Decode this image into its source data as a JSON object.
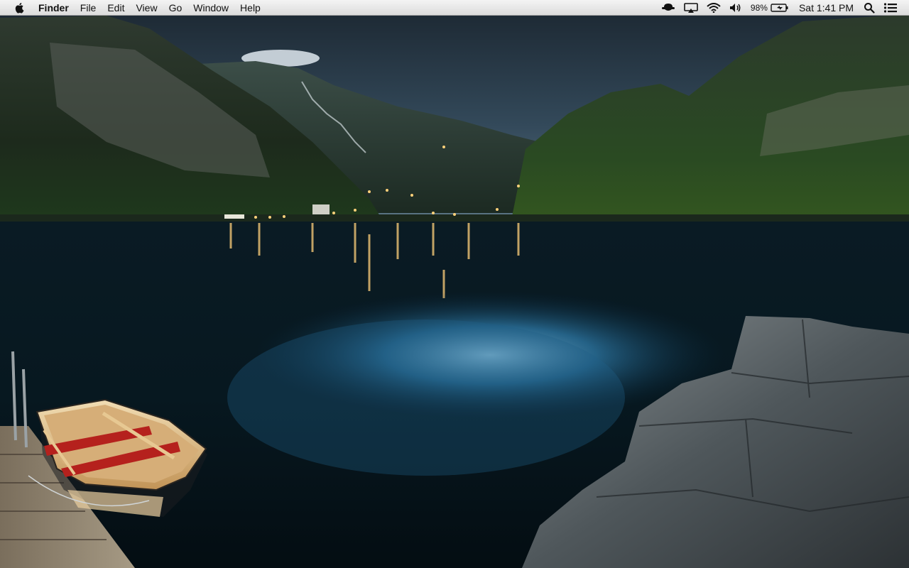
{
  "menubar": {
    "apple_icon": "apple-logo-icon",
    "app_name": "Finder",
    "menus": [
      "File",
      "Edit",
      "View",
      "Go",
      "Window",
      "Help"
    ],
    "status": {
      "user_icon": "user-silhouette-icon",
      "airplay_icon": "airplay-icon",
      "wifi_icon": "wifi-icon",
      "volume_icon": "speaker-volume-icon",
      "battery_percent": "98%",
      "battery_icon": "battery-charging-icon",
      "clock": "Sat 1:41 PM",
      "spotlight_icon": "magnifier-search-icon",
      "notification_icon": "list-notification-center-icon"
    }
  },
  "desktop": {
    "wallpaper": "fjord-night-with-rowboat-wallpaper",
    "colors": {
      "sky": "#2b3f4e",
      "water": "#06141c",
      "reflection": "#3b7ea6",
      "mountains": "#233228",
      "rocks": "#5e666b",
      "boat": "#c9a36a",
      "seat": "#b5211d",
      "lights": "#ffd17a"
    }
  }
}
